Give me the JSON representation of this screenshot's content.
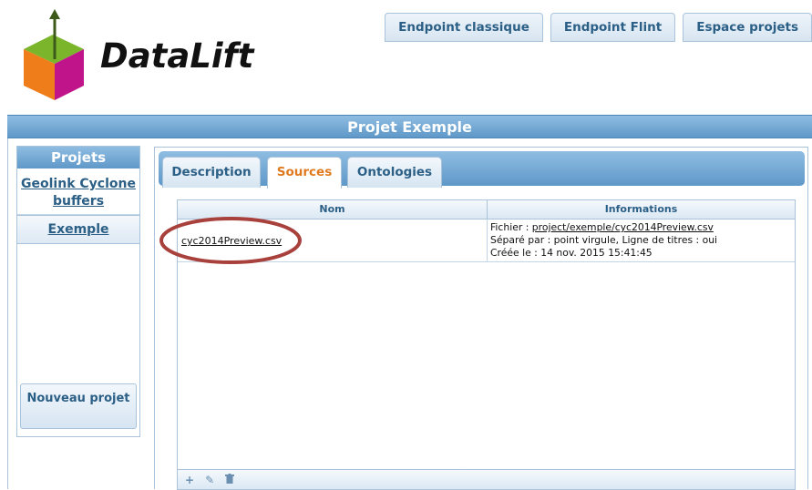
{
  "brand": {
    "name": "DataLift"
  },
  "top_nav": [
    {
      "label": "Endpoint classique"
    },
    {
      "label": "Endpoint Flint"
    },
    {
      "label": "Espace projets"
    }
  ],
  "page": {
    "title": "Projet Exemple"
  },
  "sidebar": {
    "header": "Projets",
    "items": [
      {
        "label": "Geolink Cyclone buffers",
        "active": false
      },
      {
        "label": "Exemple",
        "active": true
      }
    ],
    "new_button": "Nouveau projet"
  },
  "tabs": [
    {
      "label": "Description",
      "active": false
    },
    {
      "label": "Sources",
      "active": true
    },
    {
      "label": "Ontologies",
      "active": false
    }
  ],
  "table": {
    "columns": [
      "Nom",
      "Informations"
    ],
    "rows": [
      {
        "nom": "cyc2014Preview.csv",
        "info": {
          "fichier_label": "Fichier : ",
          "fichier_value": "project/exemple/cyc2014Preview.csv",
          "separator_line": "Séparé par : point virgule, Ligne de titres : oui",
          "created_line": "Créée le : 14 nov. 2015 15:41:45"
        }
      }
    ],
    "footer_icons": [
      "add-icon",
      "edit-icon",
      "delete-icon"
    ]
  },
  "colors": {
    "accent_blue": "#5f98c8",
    "link_blue": "#2b5f86",
    "active_tab_text": "#e07a1e",
    "highlight_ellipse": "#a8403c"
  }
}
